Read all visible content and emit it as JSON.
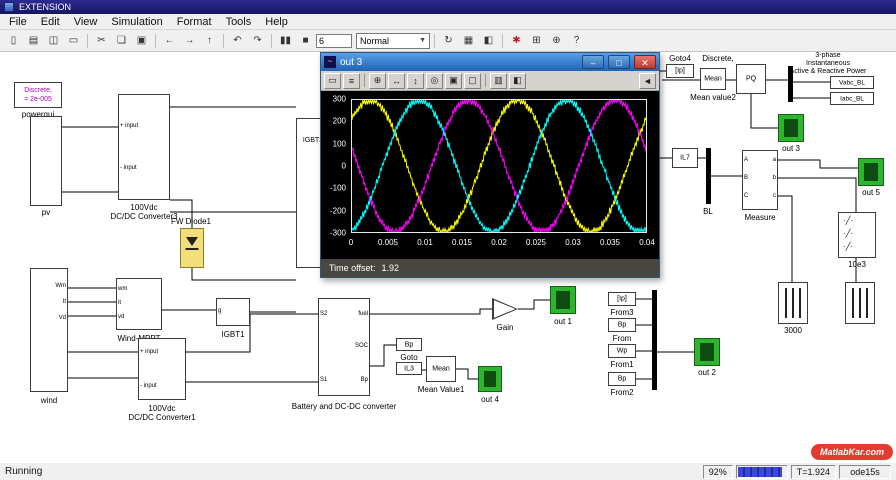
{
  "window": {
    "title": "EXTENSION"
  },
  "menu": {
    "items": [
      "File",
      "Edit",
      "View",
      "Simulation",
      "Format",
      "Tools",
      "Help"
    ]
  },
  "toolbar": {
    "buttons": [
      {
        "name": "new",
        "glyph": "▯"
      },
      {
        "name": "open",
        "glyph": "▤"
      },
      {
        "name": "save",
        "glyph": "◫"
      },
      {
        "name": "print",
        "glyph": "▭"
      },
      {
        "name": "cut",
        "glyph": "✂"
      },
      {
        "name": "copy",
        "glyph": "❏"
      },
      {
        "name": "paste",
        "glyph": "▣"
      },
      {
        "name": "back",
        "glyph": "←"
      },
      {
        "name": "forward",
        "glyph": "→"
      },
      {
        "name": "up",
        "glyph": "↑"
      },
      {
        "name": "undo",
        "glyph": "↶"
      },
      {
        "name": "redo",
        "glyph": "↷"
      },
      {
        "name": "pause",
        "glyph": "▮▮"
      },
      {
        "name": "stop",
        "glyph": "■"
      }
    ],
    "sim_time": "6",
    "sim_mode": "Normal",
    "right_buttons": [
      {
        "name": "update-diagram",
        "glyph": "↻"
      },
      {
        "name": "library-browser",
        "glyph": "▦"
      },
      {
        "name": "model-browser",
        "glyph": "◧"
      },
      {
        "name": "debug",
        "glyph": "✱"
      },
      {
        "name": "toggle-browser",
        "glyph": "⊞"
      },
      {
        "name": "zoom",
        "glyph": "⊕"
      },
      {
        "name": "help",
        "glyph": "?"
      }
    ]
  },
  "canvas": {
    "powergui": {
      "line1": "Discrete,",
      "line2": "= 2e-005",
      "label": "powergui"
    },
    "pv": {
      "label": "pv"
    },
    "conv3": {
      "port_top": "+ input",
      "port_bottom": "- input",
      "label1": "100Vdc",
      "label2": "DC/DC Converter3"
    },
    "igbt2": {
      "text": "IGBT2"
    },
    "fw_diode": {
      "label": "FW Diode1"
    },
    "wind": {
      "label": "wind",
      "ports": [
        "Wm",
        "It",
        "Vd"
      ]
    },
    "mppt": {
      "label": "Wind-MPPT",
      "ports": [
        "wm",
        "it",
        "vd"
      ]
    },
    "igbt1": {
      "label": "IGBT1",
      "port": "g"
    },
    "conv1": {
      "port_top": "+ input",
      "port_bottom": "- input",
      "label1": "100Vdc",
      "label2": "DC/DC Converter1"
    },
    "battery": {
      "label": "Battery and DC-DC converter",
      "left_ports": [
        "S2",
        "S1"
      ],
      "right_ports": [
        "fuel",
        "SOC",
        "Bp"
      ]
    },
    "goto_bp": {
      "text": "Bp",
      "label": "Goto"
    },
    "il3": {
      "text": "IL3"
    },
    "mean1": {
      "text": "Mean",
      "label": "Mean Value1"
    },
    "out4": {
      "label": "out 4"
    },
    "gain": {
      "label": "Gain"
    },
    "out1": {
      "label": "out 1"
    },
    "goto4": {
      "text": "[Ip]",
      "label": "Goto4"
    },
    "mean2": {
      "text": "Mean",
      "label_top": "Discrete,",
      "label_bottom": "Mean value2"
    },
    "pq": {
      "text": "PQ",
      "caption1": "3-phase",
      "caption2": "Instantaneous",
      "caption3": "Active & Reactive Power"
    },
    "tag_vabc": {
      "text": "Vabc_BL"
    },
    "tag_iabc": {
      "text": "Iabc_BL"
    },
    "out3": {
      "label": "out 3"
    },
    "il7": {
      "text": "IL7"
    },
    "bl": {
      "label": "BL"
    },
    "measure": {
      "label": "Measure",
      "left_ports": [
        "A",
        "B",
        "C"
      ],
      "right_ports": [
        "a",
        "b",
        "c"
      ]
    },
    "out5": {
      "label": "out 5"
    },
    "breaker": {
      "label": "10e3"
    },
    "load1": {
      "label": "3000"
    },
    "out2": {
      "label": "out 2"
    },
    "from3": {
      "text": "[Ip]",
      "label": "From3"
    },
    "from_bp": {
      "text": "Bp",
      "label": "From"
    },
    "from1": {
      "text": "Wp",
      "label": "From1"
    },
    "from2": {
      "text": "Bp",
      "label": "From2"
    }
  },
  "scope_window": {
    "title": "out 3",
    "controls": [
      {
        "name": "minimize",
        "glyph": "–"
      },
      {
        "name": "maximize",
        "glyph": "□"
      },
      {
        "name": "close",
        "glyph": "✕"
      }
    ],
    "buttons": [
      {
        "name": "print",
        "glyph": "▭"
      },
      {
        "name": "parameters",
        "glyph": "≡"
      },
      {
        "name": "zoom",
        "glyph": "⊕"
      },
      {
        "name": "zoom-x",
        "glyph": "↔"
      },
      {
        "name": "zoom-y",
        "glyph": "↕"
      },
      {
        "name": "autoscale",
        "glyph": "◎"
      },
      {
        "name": "save-axes",
        "glyph": "▣"
      },
      {
        "name": "restore-axes",
        "glyph": "▢"
      },
      {
        "name": "float-scope",
        "glyph": "▥"
      },
      {
        "name": "lock-axes",
        "glyph": "◧"
      },
      {
        "name": "dock-scope",
        "glyph": "◄"
      }
    ],
    "time_offset_label": "Time offset:",
    "time_offset_value": "1.92"
  },
  "chart_data": {
    "type": "line",
    "title": "",
    "xlabel": "",
    "ylabel": "",
    "xlim": [
      0,
      0.04
    ],
    "ylim": [
      -300,
      300
    ],
    "xticks": [
      0,
      0.005,
      0.01,
      0.015,
      0.02,
      0.025,
      0.03,
      0.035,
      0.04
    ],
    "xtick_labels": [
      "0",
      "0.005",
      "0.01",
      "0.015",
      "0.02",
      "0.025",
      "0.03",
      "0.035",
      "0.04"
    ],
    "yticks": [
      300,
      200,
      100,
      0,
      -100,
      -200,
      -300
    ],
    "background": "#000000",
    "grid": false,
    "legend": false,
    "series": [
      {
        "name": "phase-a",
        "color": "#ffff00",
        "amplitude": 300,
        "frequency_hz": 50,
        "phase_deg": 45,
        "noise": 16
      },
      {
        "name": "phase-b",
        "color": "#ff00ff",
        "amplitude": 300,
        "frequency_hz": 50,
        "phase_deg": 165,
        "noise": 16
      },
      {
        "name": "phase-c",
        "color": "#00ffff",
        "amplitude": 300,
        "frequency_hz": 50,
        "phase_deg": -75,
        "noise": 16
      }
    ],
    "time_offset": "1.92"
  },
  "status_bar": {
    "status": "Running",
    "zoom": "92%",
    "progress_pct": 92,
    "sim_time": "T=1.924",
    "solver": "ode15s"
  },
  "badge": {
    "text": "MatlabKar.com"
  }
}
